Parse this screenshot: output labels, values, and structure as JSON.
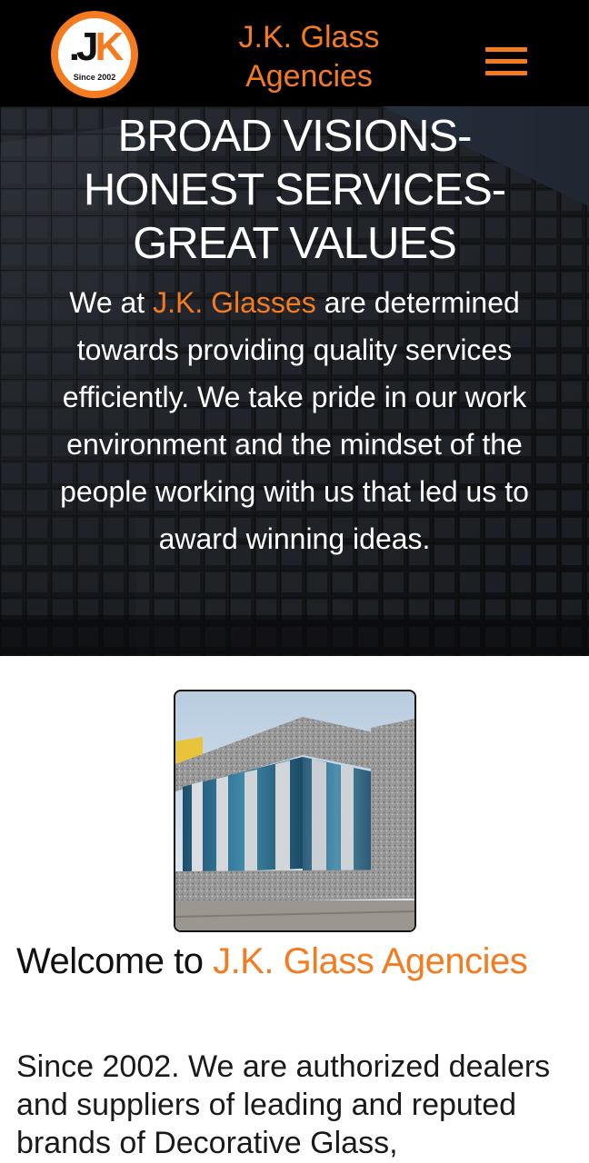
{
  "header": {
    "logo": {
      "mark_dot": ".",
      "mark_j": "J",
      "mark_k": "K",
      "since": "Since 2002"
    },
    "brand_line1": "J.K. Glass",
    "brand_line2": "Agencies",
    "menu_icon": "hamburger-menu-icon"
  },
  "hero": {
    "title_line1": "BROAD VISIONS-",
    "title_line2": "HONEST SERVICES-",
    "title_line3": "GREAT VALUES",
    "text_before": "We at ",
    "text_highlight": "J.K. Glasses",
    "text_after": " are determined towards providing quality services efficiently. We take pride in our work environment and the mindset of the people working with us that led us to award winning ideas."
  },
  "main": {
    "welcome_prefix": "Welcome to ",
    "welcome_accent": "J.K. Glass Agencies",
    "intro": "Since 2002. We are authorized dealers and suppliers of leading and reputed brands of Decorative Glass,"
  },
  "colors": {
    "accent": "#f47b20",
    "header_bg": "#000000",
    "text": "#111111"
  }
}
